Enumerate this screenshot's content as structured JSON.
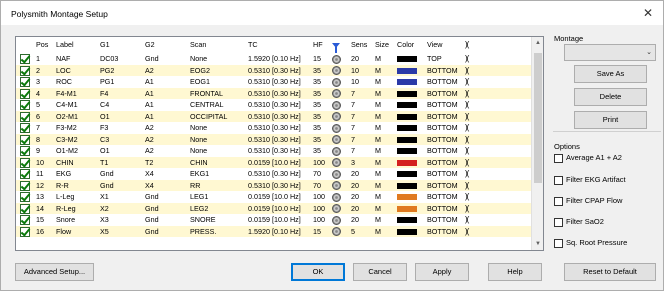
{
  "window": {
    "title": "Polysmith Montage Setup",
    "close_glyph": "✕"
  },
  "grid": {
    "headers": [
      "Pos",
      "Label",
      "G1",
      "G2",
      "Scan",
      "TC",
      "HF",
      "",
      "Sens",
      "Size",
      "Color",
      "View",
      ""
    ],
    "rows": [
      {
        "pos": "1",
        "label": "NAF",
        "g1": "DC03",
        "g2": "Gnd",
        "scan": "None",
        "tc": "1.5920 [0.10 Hz]",
        "hf": "15",
        "sens": "20",
        "size": "M",
        "color": "#000000",
        "view": "TOP"
      },
      {
        "pos": "2",
        "label": "LOC",
        "g1": "PG2",
        "g2": "A2",
        "scan": "EOG2",
        "tc": "0.5310 [0.30 Hz]",
        "hf": "35",
        "sens": "10",
        "size": "M",
        "color": "#2b3aa8",
        "view": "BOTTOM"
      },
      {
        "pos": "3",
        "label": "ROC",
        "g1": "PG1",
        "g2": "A1",
        "scan": "EOG1",
        "tc": "0.5310 [0.30 Hz]",
        "hf": "35",
        "sens": "10",
        "size": "M",
        "color": "#2b3aa8",
        "view": "BOTTOM"
      },
      {
        "pos": "4",
        "label": "F4-M1",
        "g1": "F4",
        "g2": "A1",
        "scan": "FRONTAL",
        "tc": "0.5310 [0.30 Hz]",
        "hf": "35",
        "sens": "7",
        "size": "M",
        "color": "#000000",
        "view": "BOTTOM"
      },
      {
        "pos": "5",
        "label": "C4-M1",
        "g1": "C4",
        "g2": "A1",
        "scan": "CENTRAL",
        "tc": "0.5310 [0.30 Hz]",
        "hf": "35",
        "sens": "7",
        "size": "M",
        "color": "#000000",
        "view": "BOTTOM"
      },
      {
        "pos": "6",
        "label": "O2-M1",
        "g1": "O1",
        "g2": "A1",
        "scan": "OCCIPITAL",
        "tc": "0.5310 [0.30 Hz]",
        "hf": "35",
        "sens": "7",
        "size": "M",
        "color": "#000000",
        "view": "BOTTOM"
      },
      {
        "pos": "7",
        "label": "F3-M2",
        "g1": "F3",
        "g2": "A2",
        "scan": "None",
        "tc": "0.5310 [0.30 Hz]",
        "hf": "35",
        "sens": "7",
        "size": "M",
        "color": "#000000",
        "view": "BOTTOM"
      },
      {
        "pos": "8",
        "label": "C3-M2",
        "g1": "C3",
        "g2": "A2",
        "scan": "None",
        "tc": "0.5310 [0.30 Hz]",
        "hf": "35",
        "sens": "7",
        "size": "M",
        "color": "#000000",
        "view": "BOTTOM"
      },
      {
        "pos": "9",
        "label": "O1-M2",
        "g1": "O1",
        "g2": "A2",
        "scan": "None",
        "tc": "0.5310 [0.30 Hz]",
        "hf": "35",
        "sens": "7",
        "size": "M",
        "color": "#000000",
        "view": "BOTTOM"
      },
      {
        "pos": "10",
        "label": "CHIN",
        "g1": "T1",
        "g2": "T2",
        "scan": "CHIN",
        "tc": "0.0159 [10.0 Hz]",
        "hf": "100",
        "sens": "3",
        "size": "M",
        "color": "#d42020",
        "view": "BOTTOM"
      },
      {
        "pos": "11",
        "label": "EKG",
        "g1": "Gnd",
        "g2": "X4",
        "scan": "EKG1",
        "tc": "0.5310 [0.30 Hz]",
        "hf": "70",
        "sens": "20",
        "size": "M",
        "color": "#000000",
        "view": "BOTTOM"
      },
      {
        "pos": "12",
        "label": "R-R",
        "g1": "Gnd",
        "g2": "X4",
        "scan": "RR",
        "tc": "0.5310 [0.30 Hz]",
        "hf": "70",
        "sens": "20",
        "size": "M",
        "color": "#000000",
        "view": "BOTTOM"
      },
      {
        "pos": "13",
        "label": "L-Leg",
        "g1": "X1",
        "g2": "Gnd",
        "scan": "LEG1",
        "tc": "0.0159 [10.0 Hz]",
        "hf": "100",
        "sens": "20",
        "size": "M",
        "color": "#e07a20",
        "view": "BOTTOM"
      },
      {
        "pos": "14",
        "label": "R-Leg",
        "g1": "X2",
        "g2": "Gnd",
        "scan": "LEG2",
        "tc": "0.0159 [10.0 Hz]",
        "hf": "100",
        "sens": "20",
        "size": "M",
        "color": "#e07a20",
        "view": "BOTTOM"
      },
      {
        "pos": "15",
        "label": "Snore",
        "g1": "X3",
        "g2": "Gnd",
        "scan": "SNORE",
        "tc": "0.0159 [10.0 Hz]",
        "hf": "100",
        "sens": "20",
        "size": "M",
        "color": "#000000",
        "view": "BOTTOM"
      },
      {
        "pos": "16",
        "label": "Flow",
        "g1": "X5",
        "g2": "Gnd",
        "scan": "PRESS.",
        "tc": "1.5920 [0.10 Hz]",
        "hf": "15",
        "sens": "5",
        "size": "M",
        "color": "#000000",
        "view": "BOTTOM"
      }
    ]
  },
  "buttons": {
    "advanced_setup": "Advanced Setup...",
    "ok": "OK",
    "cancel": "Cancel",
    "apply": "Apply",
    "help": "Help",
    "save_as": "Save As",
    "delete": "Delete",
    "print": "Print",
    "reset_to_default": "Reset to Default"
  },
  "montage": {
    "label": "Montage",
    "selected": ""
  },
  "options": {
    "label": "Options",
    "items": [
      "Average A1 + A2",
      "Filter EKG Artifact",
      "Filter CPAP Flow",
      "Filter SaO2",
      "Sq. Root Pressure"
    ]
  },
  "icons": {
    "filter": "funnel-icon",
    "montage_dots": "dots-icon",
    "ears": "ear-icon"
  },
  "colors": {
    "alt_row": "#fff8d2",
    "check_green": "#0a7a0a",
    "default_border": "#0078d7"
  }
}
